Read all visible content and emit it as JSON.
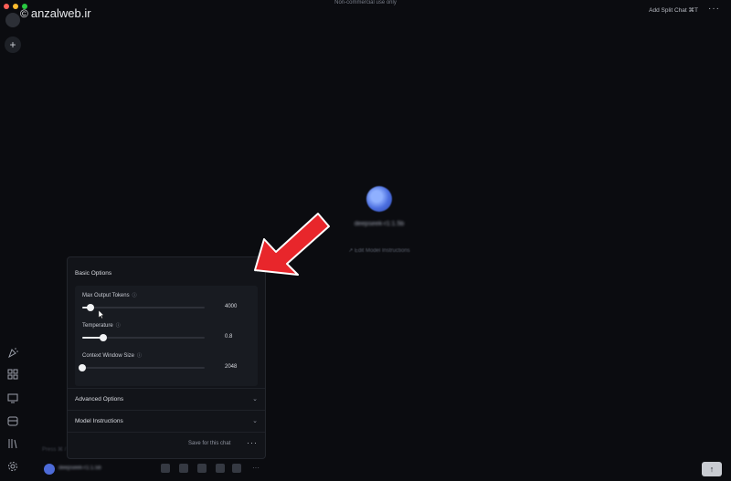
{
  "window": {
    "watermark": "anzalweb.ir",
    "watermark_symbol": "©",
    "top_center_notice": "Non-commercial use only",
    "add_split_chat": "Add Split Chat  ⌘T",
    "more_glyph": "···"
  },
  "sidebar": {
    "new_chat_glyph": "+",
    "icons": [
      "party-icon",
      "apps-icon",
      "monitor-icon",
      "folder-icon",
      "library-icon",
      "settings-icon"
    ]
  },
  "main": {
    "model_name": "deepseek-r1:1.5b",
    "edit_instructions": "↗ Edit Model Instructions"
  },
  "options_panel": {
    "basic_options": "Basic Options",
    "basic_chevron": "^",
    "options": [
      {
        "label": "Max Output Tokens",
        "value": "4000",
        "position": 0.07
      },
      {
        "label": "Temperature",
        "value": "0.8",
        "position": 0.17
      },
      {
        "label": "Context Window Size",
        "value": "2048",
        "position": 0.0
      }
    ],
    "advanced_options": "Advanced Options",
    "model_instructions": "Model Instructions",
    "save_label": "Save for this chat",
    "more_glyph": "···",
    "chevron_down": "⌄"
  },
  "bottom": {
    "input_hint": "Press ⌘ /",
    "model_label": "deepseek-r1:1.5b",
    "send_glyph": "↑"
  },
  "colors": {
    "background": "#0b0c10",
    "panel": "#121419",
    "arrow": "#e8262b"
  }
}
